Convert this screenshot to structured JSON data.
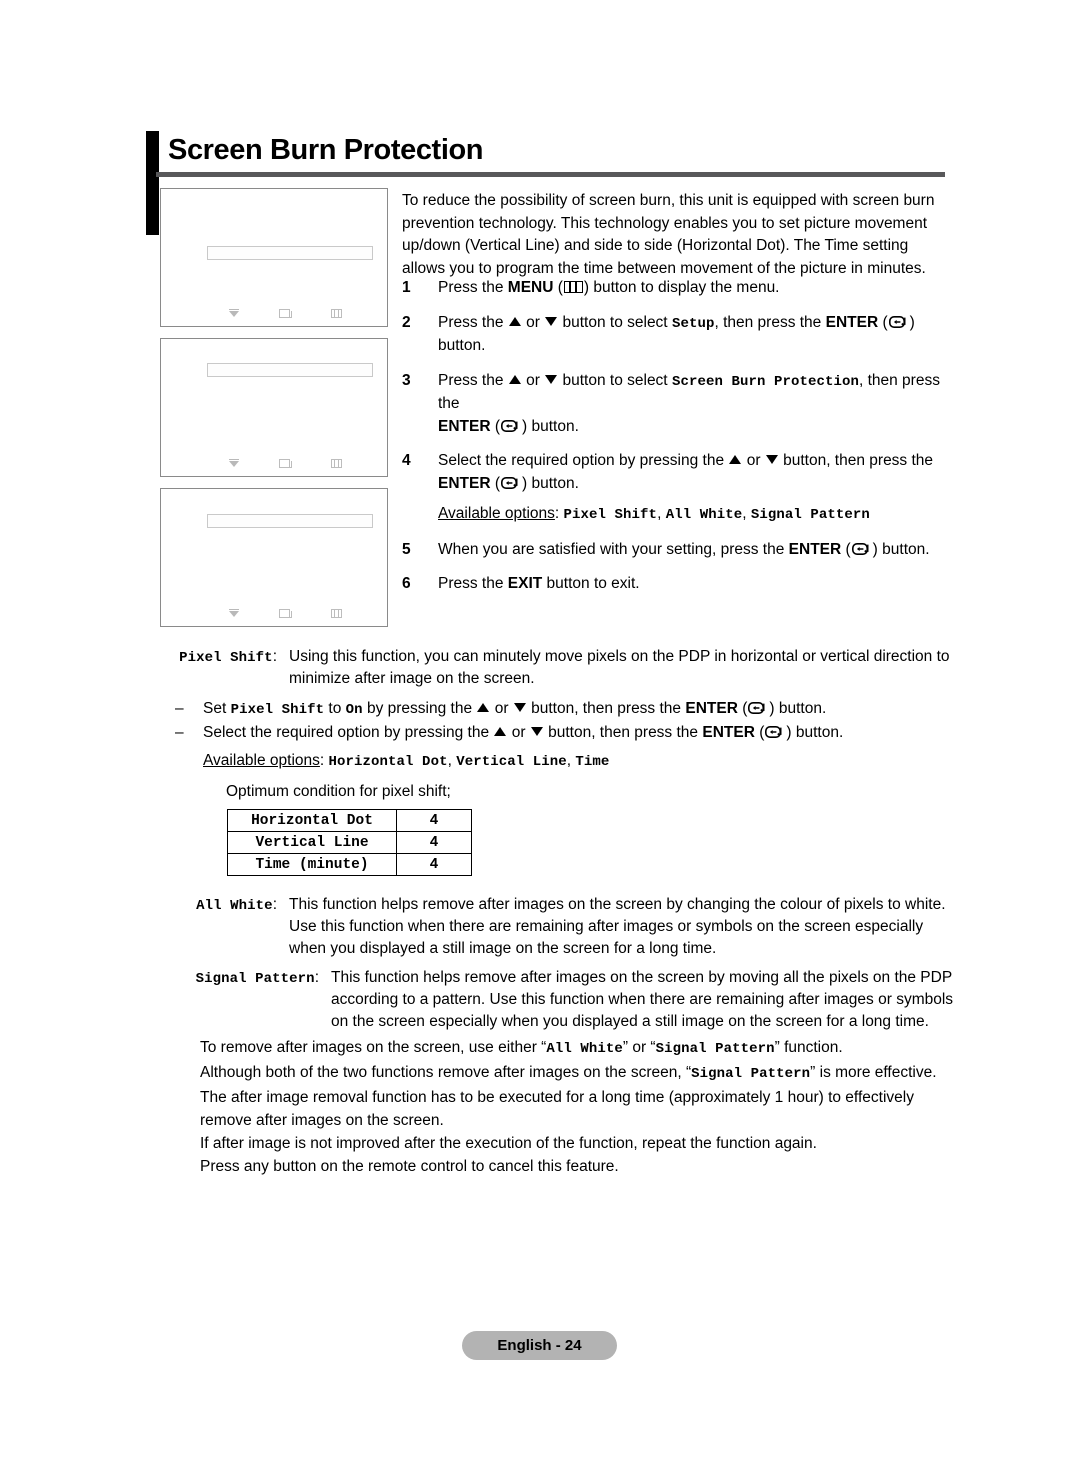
{
  "page": {
    "title": "Screen Burn Protection",
    "footer_label": "English - 24"
  },
  "intro": {
    "paragraph": "To reduce the possibility of screen burn, this unit is equipped with screen burn prevention technology. This technology enables you to set picture movement up/down (Vertical Line) and side to side (Horizontal Dot). The Time setting allows you to program the time between movement of the picture in minutes."
  },
  "steps": [
    {
      "num": "1",
      "pre": "Press the ",
      "bold1": "MENU",
      "icon": "menu-icon",
      "post": " button to display the menu."
    },
    {
      "num": "2",
      "t1": "Press the ",
      "t2": " or ",
      "t3": " button to select ",
      "mono1": "Setup",
      "t4": ", then press the ",
      "bold1": "ENTER",
      "icon": "enter-icon",
      "t5": " button."
    },
    {
      "num": "3",
      "t1": "Press the ",
      "t2": " or ",
      "t3": " button to select ",
      "mono1": "Screen Burn Protection",
      "t4": ", then press the ",
      "bold1": "ENTER",
      "icon": "enter-icon",
      "t5": " button."
    },
    {
      "num": "4",
      "t1": "Select the required option by pressing the ",
      "t2": " or ",
      "t3": " button, then press the ",
      "bold1": "ENTER",
      "icon": "enter-icon",
      "t5": " button.",
      "avail_label": "Available options",
      "avail_colon": ": ",
      "avail_opt1": "Pixel Shift",
      "avail_sep1": ", ",
      "avail_opt2": "All White",
      "avail_sep2": ", ",
      "avail_opt3": "Signal Pattern"
    },
    {
      "num": "5",
      "t1": "When you are satisfied with your setting, press the ",
      "bold1": "ENTER",
      "icon": "enter-icon",
      "t5": " button."
    },
    {
      "num": "6",
      "t1": "Press the ",
      "bold1": "EXIT",
      "t5": " button to exit."
    }
  ],
  "osd_screens": [
    {
      "name": "osd-screenshot-1"
    },
    {
      "name": "osd-screenshot-2"
    },
    {
      "name": "osd-screenshot-3"
    }
  ],
  "pixel_shift": {
    "label": "Pixel Shift",
    "label_colon": ":",
    "body": "Using this function, you can minutely move pixels on the PDP in horizontal or vertical direction to minimize after image on the screen.",
    "bullets": [
      {
        "dash": "–",
        "t1": "Set ",
        "mono1": "Pixel Shift",
        "t2": " to ",
        "mono2": "On",
        "t3": " by pressing the ",
        "t4": " or ",
        "t5": " button, then press the ",
        "bold1": "ENTER",
        "t6": " button."
      },
      {
        "dash": "–",
        "t1": "Select the required option by pressing the ",
        "t4": " or ",
        "t5": " button, then press the ",
        "bold1": "ENTER",
        "t6": " button."
      }
    ],
    "avail_label": "Available options",
    "avail_colon": ": ",
    "avail_opt1": "Horizontal Dot",
    "avail_sep1": ", ",
    "avail_opt2": "Vertical Line",
    "avail_sep2": ", ",
    "avail_opt3": "Time",
    "optimum_caption": "Optimum condition for pixel shift;",
    "table": {
      "rows": [
        {
          "key": "Horizontal Dot",
          "value": "4"
        },
        {
          "key": "Vertical Line",
          "value": "4"
        },
        {
          "key": "Time (minute)",
          "value": "4"
        }
      ]
    }
  },
  "all_white": {
    "label": "All White",
    "label_colon": ":",
    "body": "This function helps remove after images on the screen by changing the colour of pixels to white. Use this function when there are remaining after images or symbols on the screen especially when you displayed a still image on the screen for a long time."
  },
  "signal_pattern": {
    "label": "Signal Pattern",
    "label_colon": ":",
    "body": "This function helps remove after images on the screen by moving all the pixels on the PDP according to a pattern. Use this function when there are remaining after images or symbols on the screen especially when you displayed a still image on the screen for a long time."
  },
  "closing": {
    "line1_a": "To remove after images on the screen, use either “",
    "line1_m1": "All White",
    "line1_b": "” or “",
    "line1_m2": "Signal Pattern",
    "line1_c": "” function.",
    "line2_a": "Although both of the two functions remove after images on the screen, “",
    "line2_m1": "Signal Pattern",
    "line2_b": "” is more effective.",
    "line3": "The after image removal function has to be executed for a long time (approximately 1 hour) to effectively remove after images on the screen.",
    "line4": "If after image is not improved after the execution of the function, repeat the function again.",
    "line5": "Press any button on the remote control to cancel this feature."
  },
  "colors": {
    "rule": "#58585a",
    "footer_pill": "#b3b3b3",
    "osd_border": "#8a8a8a"
  }
}
